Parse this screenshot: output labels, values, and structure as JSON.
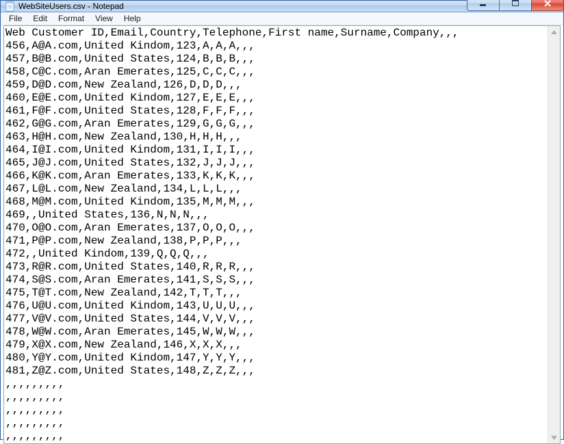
{
  "title": "WebSiteUsers.csv - Notepad",
  "menu": {
    "file": "File",
    "edit": "Edit",
    "format": "Format",
    "view": "View",
    "help": "Help"
  },
  "content": "Web Customer ID,Email,Country,Telephone,First name,Surname,Company,,,\n456,A@A.com,United Kindom,123,A,A,A,,,\n457,B@B.com,United States,124,B,B,B,,,\n458,C@C.com,Aran Emerates,125,C,C,C,,,\n459,D@D.com,New Zealand,126,D,D,D,,,\n460,E@E.com,United Kindom,127,E,E,E,,,\n461,F@F.com,United States,128,F,F,F,,,\n462,G@G.com,Aran Emerates,129,G,G,G,,,\n463,H@H.com,New Zealand,130,H,H,H,,,\n464,I@I.com,United Kindom,131,I,I,I,,,\n465,J@J.com,United States,132,J,J,J,,,\n466,K@K.com,Aran Emerates,133,K,K,K,,,\n467,L@L.com,New Zealand,134,L,L,L,,,\n468,M@M.com,United Kindom,135,M,M,M,,,\n469,,United States,136,N,N,N,,,\n470,O@O.com,Aran Emerates,137,O,O,O,,,\n471,P@P.com,New Zealand,138,P,P,P,,,\n472,,United Kindom,139,Q,Q,Q,,,\n473,R@R.com,United States,140,R,R,R,,,\n474,S@S.com,Aran Emerates,141,S,S,S,,,\n475,T@T.com,New Zealand,142,T,T,T,,,\n476,U@U.com,United Kindom,143,U,U,U,,,\n477,V@V.com,United States,144,V,V,V,,,\n478,W@W.com,Aran Emerates,145,W,W,W,,,\n479,X@X.com,New Zealand,146,X,X,X,,,\n480,Y@Y.com,United Kindom,147,Y,Y,Y,,,\n481,Z@Z.com,United States,148,Z,Z,Z,,,\n,,,,,,,,,\n,,,,,,,,,\n,,,,,,,,,\n,,,,,,,,,\n,,,,,,,,,"
}
